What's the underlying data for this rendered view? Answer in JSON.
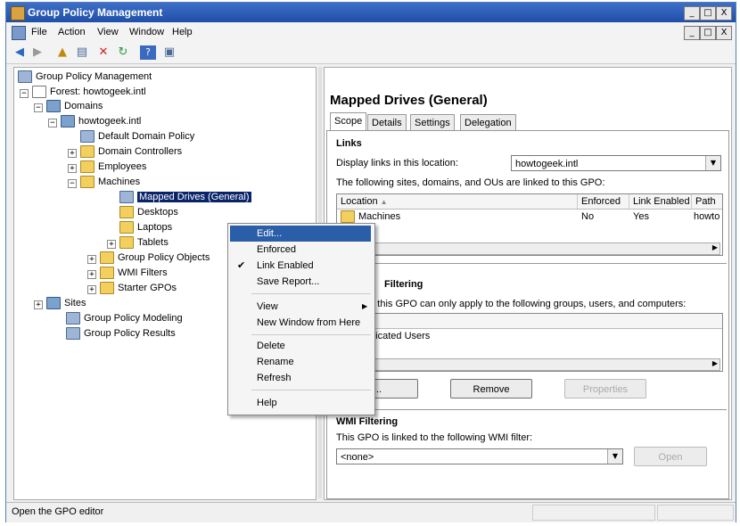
{
  "window": {
    "title": "Group Policy Management",
    "caption_buttons": [
      "_",
      "□",
      "X"
    ]
  },
  "menu": [
    "File",
    "Action",
    "View",
    "Window",
    "Help"
  ],
  "toolbar_icons": [
    "back-icon",
    "forward-icon",
    "up-icon",
    "properties-icon",
    "delete-icon",
    "refresh-icon",
    "help-icon",
    "console-icon"
  ],
  "tree": {
    "root": "Group Policy Management",
    "forest": "Forest: howtogeek.intl",
    "domains": "Domains",
    "domain": "howtogeek.intl",
    "default_policy": "Default Domain Policy",
    "domain_controllers": "Domain Controllers",
    "employees": "Employees",
    "machines": "Machines",
    "mapped_drives": "Mapped Drives (General)",
    "desktops": "Desktops",
    "laptops": "Laptops",
    "tablets": "Tablets",
    "gpo_objects": "Group Policy Objects",
    "wmi_filters": "WMI Filters",
    "starter_gpos": "Starter GPOs",
    "sites": "Sites",
    "modeling": "Group Policy Modeling",
    "results": "Group Policy Results"
  },
  "details": {
    "title": "Mapped Drives (General)",
    "tabs": [
      "Scope",
      "Details",
      "Settings",
      "Delegation"
    ],
    "links_title": "Links",
    "display_links_label": "Display links in this location:",
    "display_links_value": "howtogeek.intl",
    "linked_text": "The following sites, domains, and OUs are linked to this GPO:",
    "links_columns": [
      "Location",
      "Enforced",
      "Link Enabled",
      "Path"
    ],
    "links_rows": [
      {
        "location": "Machines",
        "enforced": "No",
        "link_enabled": "Yes",
        "path": "howto"
      }
    ],
    "security_title_visible": "Filtering",
    "security_text_visible": "gs in this GPO can only apply to the following groups, users, and computers:",
    "security_row_visible": "nticated Users",
    "add_btn_visible": "dd...",
    "remove_btn": "Remove",
    "properties_btn": "Properties",
    "wmi_title": "WMI Filtering",
    "wmi_text": "This GPO is linked to the following WMI filter:",
    "wmi_value": "<none>",
    "open_btn": "Open"
  },
  "context_menu": {
    "items": [
      "Edit...",
      "Enforced",
      "Link Enabled",
      "Save Report...",
      "View",
      "New Window from Here",
      "Delete",
      "Rename",
      "Refresh",
      "Help"
    ],
    "checked": "Link Enabled",
    "highlighted": "Edit..."
  },
  "status": "Open the GPO editor"
}
